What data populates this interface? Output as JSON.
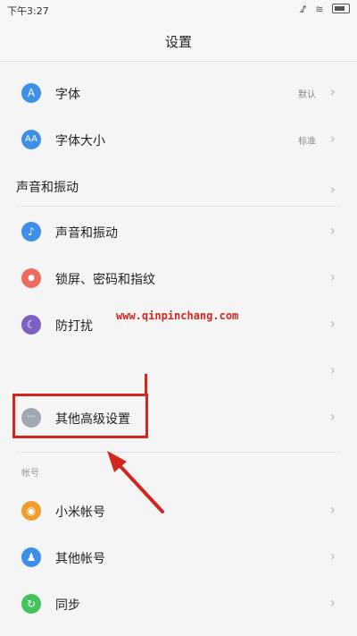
{
  "status_bar": {
    "time": "下午3:27"
  },
  "header": {
    "title": "设置"
  },
  "rows": [
    {
      "icon": "font-icon",
      "glyph": "A",
      "color": "#3d8fe8",
      "label": "字体",
      "value": "默认"
    },
    {
      "icon": "font-size-icon",
      "glyph": "AA",
      "color": "#3d8fe8",
      "label": "字体大小",
      "value": "标准"
    },
    {
      "label": "声音和振动"
    },
    {
      "icon": "speaker-icon",
      "glyph": "♪",
      "color": "#3d8fe8",
      "label": "声音和振动"
    },
    {
      "icon": "lock-icon",
      "glyph": "●",
      "color": "#ee6b5e",
      "label": "锁屏、密码和指纹"
    },
    {
      "icon": "moon-icon",
      "glyph": "☾",
      "color": "#7d60c3",
      "label": "防打扰"
    },
    {
      "icon": "more-icon",
      "glyph": "···",
      "color": "#a0a7b4",
      "label": "其他高级设置"
    },
    {
      "icon": "mi-account-icon",
      "glyph": "◉",
      "color": "#f19c2d",
      "label": "小米帐号"
    },
    {
      "icon": "account-icon",
      "glyph": "♟",
      "color": "#3d8fe8",
      "label": "其他帐号"
    },
    {
      "icon": "sync-icon",
      "glyph": "↻",
      "color": "#42c35b",
      "label": "同步"
    }
  ],
  "section": {
    "accounts_label": "帐号"
  },
  "watermark": "www.qinpinchang.com",
  "annotation": {
    "color": "#d2261f"
  }
}
